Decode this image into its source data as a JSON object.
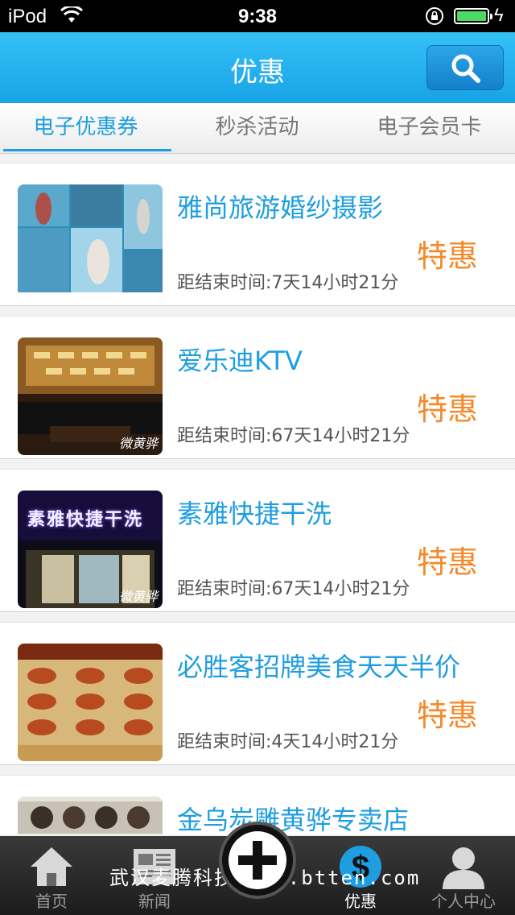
{
  "status_bar": {
    "carrier": "iPod",
    "time": "9:38"
  },
  "nav": {
    "title": "优惠"
  },
  "tabs": [
    {
      "label": "电子优惠券",
      "active": true
    },
    {
      "label": "秒杀活动",
      "active": false
    },
    {
      "label": "电子会员卡",
      "active": false
    }
  ],
  "list": [
    {
      "name": "雅尚旅游婚纱摄影",
      "badge": "特惠",
      "remain": "距结束时间:7天14小时21分",
      "thumb": "wedding-photos"
    },
    {
      "name": "爱乐迪KTV",
      "badge": "特惠",
      "remain": "距结束时间:67天14小时21分",
      "thumb": "ktv-room",
      "thumb_mark": "微黄骅"
    },
    {
      "name": "素雅快捷干洗",
      "badge": "特惠",
      "remain": "距结束时间:67天14小时21分",
      "thumb": "laundry-storefront",
      "thumb_sign": "素雅快捷干洗",
      "thumb_mark": "微黄骅"
    },
    {
      "name": "必胜客招牌美食天天半价",
      "badge": "特惠",
      "remain": "距结束时间:4天14小时21分",
      "thumb": "pizza-menu"
    },
    {
      "name": "金乌炭雕黄骅专卖店",
      "badge": "",
      "remain": "",
      "thumb": "carving-shelf"
    }
  ],
  "tabbar": [
    {
      "label": "首页",
      "icon": "home-icon",
      "active": false
    },
    {
      "label": "新闻",
      "icon": "news-icon",
      "active": false
    },
    {
      "label": "",
      "icon": "plus-icon",
      "active": false
    },
    {
      "label": "优惠",
      "icon": "dollar-icon",
      "active": true
    },
    {
      "label": "个人中心",
      "icon": "person-icon",
      "active": false
    }
  ],
  "watermark": "武汉麦腾科技 www.btten.com",
  "colors": {
    "accent": "#1e9ee0",
    "badge": "#f5892a",
    "navbar": "#22aaea"
  }
}
